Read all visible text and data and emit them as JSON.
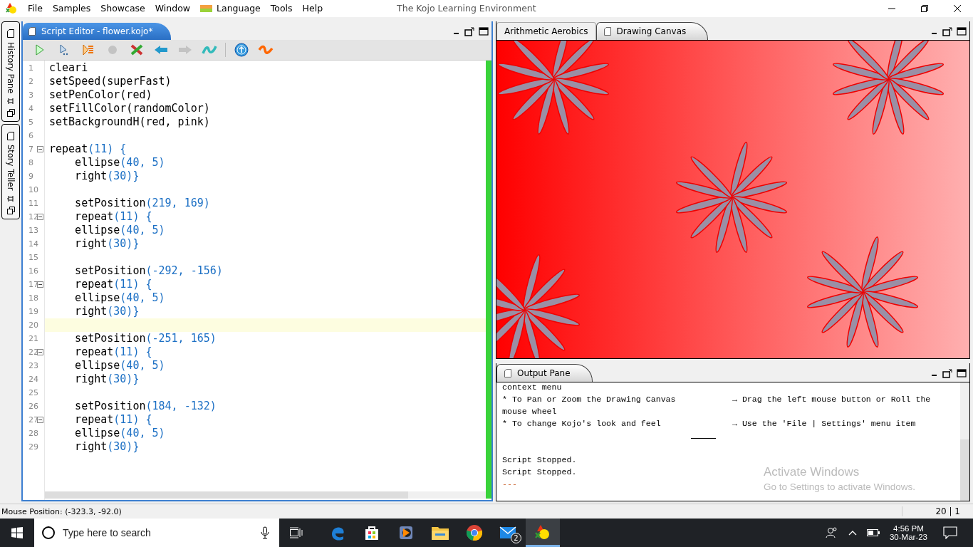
{
  "app_bar": {
    "menu": [
      "File",
      "Samples",
      "Showcase",
      "Window",
      "Language",
      "Tools",
      "Help"
    ],
    "title": "The Kojo Learning Environment"
  },
  "side_tabs": [
    {
      "label": "History Pane"
    },
    {
      "label": "Story Teller"
    }
  ],
  "editor": {
    "tab": "Script Editor - flower.kojo*",
    "toolbar": [
      {
        "kind": "run",
        "disabled": false
      },
      {
        "kind": "step",
        "disabled": false
      },
      {
        "kind": "trace",
        "disabled": false
      },
      {
        "kind": "stop",
        "disabled": true
      },
      {
        "kind": "clear",
        "disabled": false
      },
      {
        "kind": "undo",
        "disabled": false
      },
      {
        "kind": "redo",
        "disabled": true
      },
      {
        "kind": "format",
        "disabled": false
      },
      {
        "kind": "upload",
        "disabled": false
      },
      {
        "kind": "squiggle",
        "disabled": false
      }
    ],
    "lines": [
      {
        "number": "1",
        "text": "cleari",
        "fold": false,
        "current": false
      },
      {
        "number": "2",
        "text": "setSpeed(superFast)",
        "fold": false,
        "current": false
      },
      {
        "number": "3",
        "text": "setPenColor(red)",
        "fold": false,
        "current": false
      },
      {
        "number": "4",
        "text": "setFillColor(randomColor)",
        "fold": false,
        "current": false
      },
      {
        "number": "5",
        "text": "setBackgroundH(red, pink)",
        "fold": false,
        "current": false
      },
      {
        "number": "6",
        "fold": false,
        "current": false
      },
      {
        "number": "7",
        "text": "repeat(11) {",
        "fold": true,
        "current": false
      },
      {
        "number": "8",
        "text": "    ellipse(40, 5)",
        "fold": false,
        "current": false
      },
      {
        "number": "9",
        "text": "    right(30)}",
        "fold": false,
        "current": false
      },
      {
        "number": "10",
        "fold": false,
        "current": false
      },
      {
        "number": "11",
        "text": "    setPosition(219, 169)",
        "fold": false,
        "current": false
      },
      {
        "number": "12",
        "text": "    repeat(11) {",
        "fold": true,
        "current": false
      },
      {
        "number": "13",
        "text": "    ellipse(40, 5)",
        "fold": false,
        "current": false
      },
      {
        "number": "14",
        "text": "    right(30)}",
        "fold": false,
        "current": false
      },
      {
        "number": "15",
        "fold": false,
        "current": false
      },
      {
        "number": "16",
        "text": "    setPosition(-292, -156)",
        "fold": false,
        "current": false
      },
      {
        "number": "17",
        "text": "    repeat(11) {",
        "fold": true,
        "current": false
      },
      {
        "number": "18",
        "text": "    ellipse(40, 5)",
        "fold": false,
        "current": false
      },
      {
        "number": "19",
        "text": "    right(30)}",
        "fold": false,
        "current": false
      },
      {
        "number": "20",
        "fold": false,
        "current": true
      },
      {
        "number": "21",
        "text": "    setPosition(-251, 165)",
        "fold": false,
        "current": false
      },
      {
        "number": "22",
        "text": "    repeat(11) {",
        "fold": true,
        "current": false
      },
      {
        "number": "23",
        "text": "    ellipse(40, 5)",
        "fold": false,
        "current": false
      },
      {
        "number": "24",
        "text": "    right(30)}",
        "fold": false,
        "current": false
      },
      {
        "number": "25",
        "fold": false,
        "current": false
      },
      {
        "number": "26",
        "text": "    setPosition(184, -132)",
        "fold": false,
        "current": false
      },
      {
        "number": "27",
        "text": "    repeat(11) {",
        "fold": true,
        "current": false
      },
      {
        "number": "28",
        "text": "    ellipse(40, 5)",
        "fold": false,
        "current": false
      },
      {
        "number": "29",
        "text": "    right(30)}",
        "fold": false,
        "current": false
      }
    ]
  },
  "canvas_tabs": [
    {
      "label": "Arithmetic Aerobics",
      "selected": false
    },
    {
      "label": "Drawing Canvas",
      "selected": true
    }
  ],
  "output": {
    "tab": "Output Pane",
    "lines": [
      {
        "kind": "text",
        "text": "context menu"
      },
      {
        "kind": "pair",
        "action": "* To Pan or Zoom the Drawing Canvas",
        "how": "→ Drag the left mouse button or Roll the"
      },
      {
        "kind": "text",
        "text": "mouse wheel"
      },
      {
        "kind": "pair",
        "action": "* To change Kojo's look and feel",
        "how": "→ Use the 'File | Settings' menu item"
      },
      {
        "kind": "rule"
      },
      {
        "kind": "blank"
      },
      {
        "kind": "text",
        "text": "Script Stopped."
      },
      {
        "kind": "text",
        "text": "Script Stopped."
      },
      {
        "kind": "marker",
        "text": "---"
      }
    ],
    "notice": {
      "title": "Activate Windows",
      "text": "Go to Settings to activate Windows."
    }
  },
  "status_bar": {
    "mouse": "Mouse Position: (-323.3, -92.0)",
    "caret": "20 | 1"
  },
  "taskbar": {
    "search_placeholder": "Type here to search",
    "apps": [
      {
        "kind": "edge",
        "active": false
      },
      {
        "kind": "store",
        "active": false
      },
      {
        "kind": "media",
        "active": false
      },
      {
        "kind": "explorer",
        "active": false
      },
      {
        "kind": "chrome",
        "active": false
      },
      {
        "kind": "mail",
        "active": false,
        "badge": "2"
      },
      {
        "kind": "kojo",
        "active": true
      }
    ],
    "time": "4:56 PM",
    "date": "30-Mar-23"
  }
}
